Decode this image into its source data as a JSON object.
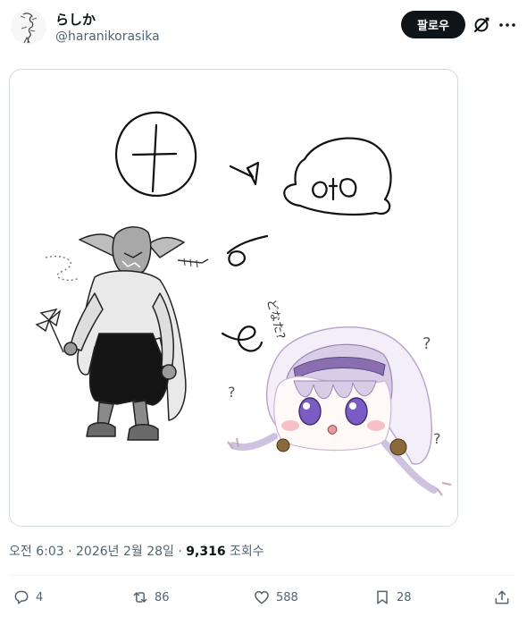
{
  "author": {
    "display_name": "らしか",
    "handle": "@haranikorasika"
  },
  "header": {
    "follow_label": "팔로우",
    "grok_icon": "grok-slash-icon",
    "more_icon": "more-dots-icon"
  },
  "media": {
    "handwritten_text": "どなた?",
    "question_mark": "?"
  },
  "meta": {
    "time": "오전 6:03",
    "separator": "·",
    "date": "2026년 2월 28일",
    "views_count": "9,316",
    "views_label": "조회수"
  },
  "actions": {
    "replies": "4",
    "reposts": "86",
    "likes": "588",
    "bookmarks": "28"
  },
  "colors": {
    "text": "#0f1419",
    "secondary": "#536471",
    "border": "#cfd9de",
    "hair": "#d8cde6",
    "eyes": "#7b5cc4",
    "headband": "#8a6fb0"
  }
}
